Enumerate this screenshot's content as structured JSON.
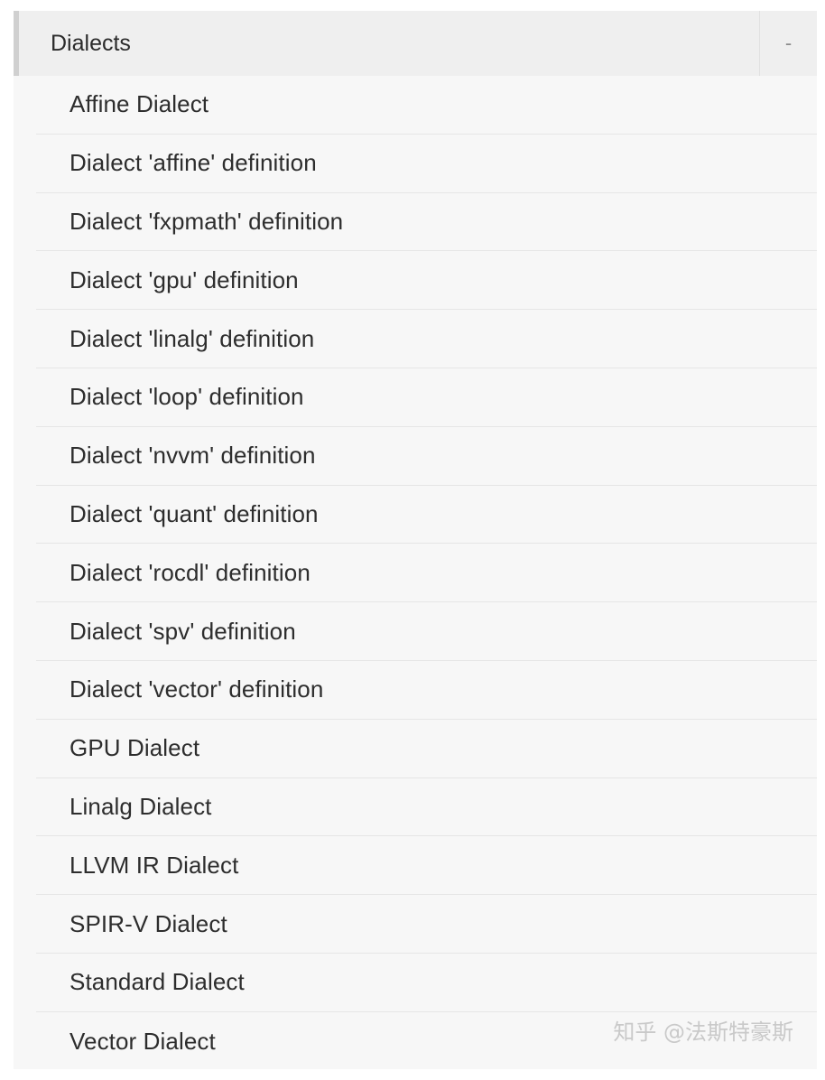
{
  "section": {
    "title": "Dialects",
    "collapse_symbol": "-"
  },
  "items": [
    {
      "label": "Affine Dialect"
    },
    {
      "label": "Dialect 'affine' definition"
    },
    {
      "label": "Dialect 'fxpmath' definition"
    },
    {
      "label": "Dialect 'gpu' definition"
    },
    {
      "label": "Dialect 'linalg' definition"
    },
    {
      "label": "Dialect 'loop' definition"
    },
    {
      "label": "Dialect 'nvvm' definition"
    },
    {
      "label": "Dialect 'quant' definition"
    },
    {
      "label": "Dialect 'rocdl' definition"
    },
    {
      "label": "Dialect 'spv' definition"
    },
    {
      "label": "Dialect 'vector' definition"
    },
    {
      "label": "GPU Dialect"
    },
    {
      "label": "Linalg Dialect"
    },
    {
      "label": "LLVM IR Dialect"
    },
    {
      "label": "SPIR-V Dialect"
    },
    {
      "label": "Standard Dialect"
    },
    {
      "label": "Vector Dialect"
    }
  ],
  "watermark": "知乎 @法斯特豪斯",
  "colors": {
    "panel_bg": "#f7f7f7",
    "header_bg": "#efefef",
    "text": "#2d2d2d",
    "divider": "#e6e6e6"
  }
}
